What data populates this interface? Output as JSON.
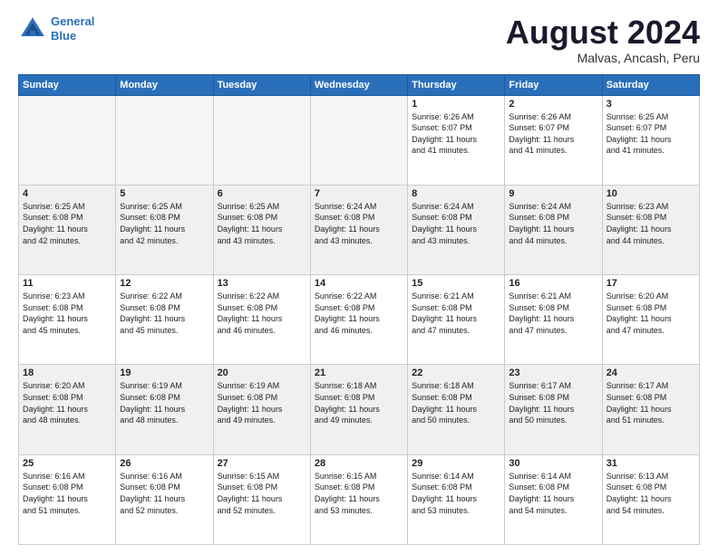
{
  "header": {
    "logo_line1": "General",
    "logo_line2": "Blue",
    "title": "August 2024",
    "subtitle": "Malvas, Ancash, Peru"
  },
  "days_of_week": [
    "Sunday",
    "Monday",
    "Tuesday",
    "Wednesday",
    "Thursday",
    "Friday",
    "Saturday"
  ],
  "weeks": [
    [
      {
        "day": "",
        "info": "",
        "empty": true
      },
      {
        "day": "",
        "info": "",
        "empty": true
      },
      {
        "day": "",
        "info": "",
        "empty": true
      },
      {
        "day": "",
        "info": "",
        "empty": true
      },
      {
        "day": "1",
        "info": "Sunrise: 6:26 AM\nSunset: 6:07 PM\nDaylight: 11 hours\nand 41 minutes."
      },
      {
        "day": "2",
        "info": "Sunrise: 6:26 AM\nSunset: 6:07 PM\nDaylight: 11 hours\nand 41 minutes."
      },
      {
        "day": "3",
        "info": "Sunrise: 6:25 AM\nSunset: 6:07 PM\nDaylight: 11 hours\nand 41 minutes."
      }
    ],
    [
      {
        "day": "4",
        "info": "Sunrise: 6:25 AM\nSunset: 6:08 PM\nDaylight: 11 hours\nand 42 minutes.",
        "shaded": true
      },
      {
        "day": "5",
        "info": "Sunrise: 6:25 AM\nSunset: 6:08 PM\nDaylight: 11 hours\nand 42 minutes.",
        "shaded": true
      },
      {
        "day": "6",
        "info": "Sunrise: 6:25 AM\nSunset: 6:08 PM\nDaylight: 11 hours\nand 43 minutes.",
        "shaded": true
      },
      {
        "day": "7",
        "info": "Sunrise: 6:24 AM\nSunset: 6:08 PM\nDaylight: 11 hours\nand 43 minutes.",
        "shaded": true
      },
      {
        "day": "8",
        "info": "Sunrise: 6:24 AM\nSunset: 6:08 PM\nDaylight: 11 hours\nand 43 minutes.",
        "shaded": true
      },
      {
        "day": "9",
        "info": "Sunrise: 6:24 AM\nSunset: 6:08 PM\nDaylight: 11 hours\nand 44 minutes.",
        "shaded": true
      },
      {
        "day": "10",
        "info": "Sunrise: 6:23 AM\nSunset: 6:08 PM\nDaylight: 11 hours\nand 44 minutes.",
        "shaded": true
      }
    ],
    [
      {
        "day": "11",
        "info": "Sunrise: 6:23 AM\nSunset: 6:08 PM\nDaylight: 11 hours\nand 45 minutes."
      },
      {
        "day": "12",
        "info": "Sunrise: 6:22 AM\nSunset: 6:08 PM\nDaylight: 11 hours\nand 45 minutes."
      },
      {
        "day": "13",
        "info": "Sunrise: 6:22 AM\nSunset: 6:08 PM\nDaylight: 11 hours\nand 46 minutes."
      },
      {
        "day": "14",
        "info": "Sunrise: 6:22 AM\nSunset: 6:08 PM\nDaylight: 11 hours\nand 46 minutes."
      },
      {
        "day": "15",
        "info": "Sunrise: 6:21 AM\nSunset: 6:08 PM\nDaylight: 11 hours\nand 47 minutes."
      },
      {
        "day": "16",
        "info": "Sunrise: 6:21 AM\nSunset: 6:08 PM\nDaylight: 11 hours\nand 47 minutes."
      },
      {
        "day": "17",
        "info": "Sunrise: 6:20 AM\nSunset: 6:08 PM\nDaylight: 11 hours\nand 47 minutes."
      }
    ],
    [
      {
        "day": "18",
        "info": "Sunrise: 6:20 AM\nSunset: 6:08 PM\nDaylight: 11 hours\nand 48 minutes.",
        "shaded": true
      },
      {
        "day": "19",
        "info": "Sunrise: 6:19 AM\nSunset: 6:08 PM\nDaylight: 11 hours\nand 48 minutes.",
        "shaded": true
      },
      {
        "day": "20",
        "info": "Sunrise: 6:19 AM\nSunset: 6:08 PM\nDaylight: 11 hours\nand 49 minutes.",
        "shaded": true
      },
      {
        "day": "21",
        "info": "Sunrise: 6:18 AM\nSunset: 6:08 PM\nDaylight: 11 hours\nand 49 minutes.",
        "shaded": true
      },
      {
        "day": "22",
        "info": "Sunrise: 6:18 AM\nSunset: 6:08 PM\nDaylight: 11 hours\nand 50 minutes.",
        "shaded": true
      },
      {
        "day": "23",
        "info": "Sunrise: 6:17 AM\nSunset: 6:08 PM\nDaylight: 11 hours\nand 50 minutes.",
        "shaded": true
      },
      {
        "day": "24",
        "info": "Sunrise: 6:17 AM\nSunset: 6:08 PM\nDaylight: 11 hours\nand 51 minutes.",
        "shaded": true
      }
    ],
    [
      {
        "day": "25",
        "info": "Sunrise: 6:16 AM\nSunset: 6:08 PM\nDaylight: 11 hours\nand 51 minutes."
      },
      {
        "day": "26",
        "info": "Sunrise: 6:16 AM\nSunset: 6:08 PM\nDaylight: 11 hours\nand 52 minutes."
      },
      {
        "day": "27",
        "info": "Sunrise: 6:15 AM\nSunset: 6:08 PM\nDaylight: 11 hours\nand 52 minutes."
      },
      {
        "day": "28",
        "info": "Sunrise: 6:15 AM\nSunset: 6:08 PM\nDaylight: 11 hours\nand 53 minutes."
      },
      {
        "day": "29",
        "info": "Sunrise: 6:14 AM\nSunset: 6:08 PM\nDaylight: 11 hours\nand 53 minutes."
      },
      {
        "day": "30",
        "info": "Sunrise: 6:14 AM\nSunset: 6:08 PM\nDaylight: 11 hours\nand 54 minutes."
      },
      {
        "day": "31",
        "info": "Sunrise: 6:13 AM\nSunset: 6:08 PM\nDaylight: 11 hours\nand 54 minutes."
      }
    ]
  ]
}
